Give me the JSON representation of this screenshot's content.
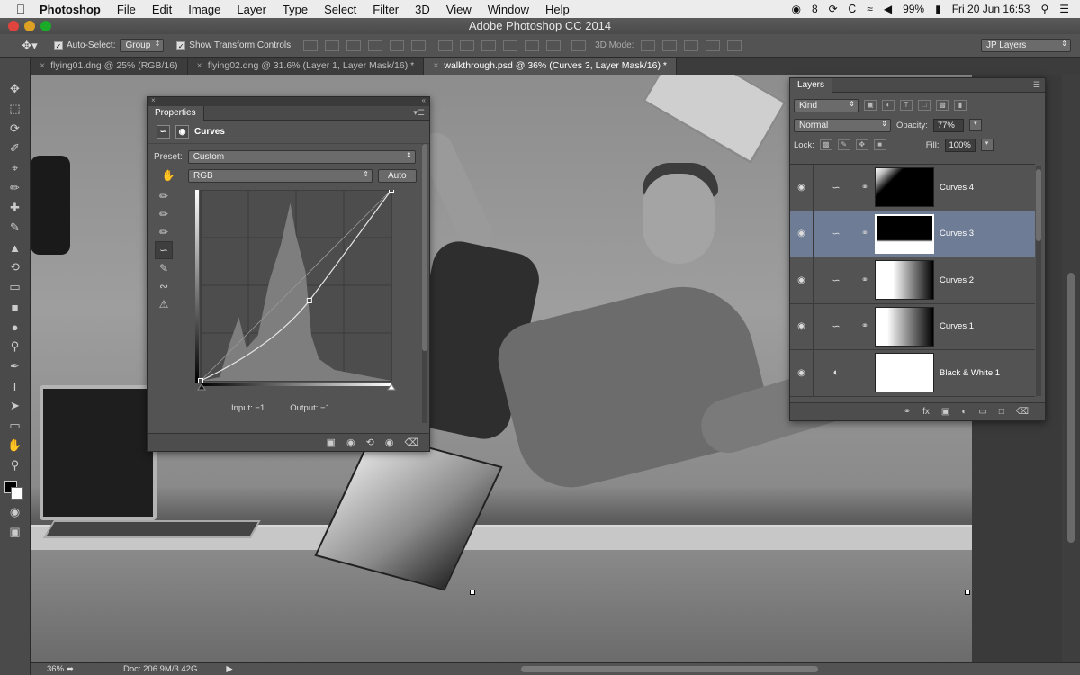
{
  "menubar": {
    "apple_icon": "apple-icon",
    "app_name": "Photoshop",
    "menus": [
      "File",
      "Edit",
      "Image",
      "Layer",
      "Type",
      "Select",
      "Filter",
      "3D",
      "View",
      "Window",
      "Help"
    ],
    "status": {
      "cc_badge": "8",
      "battery": "99%",
      "datetime": "Fri 20 Jun  16:53"
    }
  },
  "window": {
    "title": "Adobe Photoshop CC 2014"
  },
  "options_bar": {
    "auto_select_label": "Auto-Select:",
    "auto_select_value": "Group",
    "show_transform_label": "Show Transform Controls",
    "mode_3d_label": "3D Mode:",
    "workspace_value": "JP Layers"
  },
  "tabs": [
    {
      "label": "flying01.dng @ 25% (RGB/16)",
      "active": false
    },
    {
      "label": "flying02.dng @ 31.6% (Layer 1, Layer Mask/16) *",
      "active": false
    },
    {
      "label": "walkthrough.psd @ 36% (Curves 3, Layer Mask/16) *",
      "active": true
    }
  ],
  "status_bar": {
    "zoom": "36%",
    "doc": "Doc: 206.9M/3.42G"
  },
  "properties": {
    "tab_label": "Properties",
    "header_label": "Curves",
    "preset_label": "Preset:",
    "preset_value": "Custom",
    "channel_value": "RGB",
    "auto_button": "Auto",
    "input_label": "Input: −1",
    "output_label": "Output: −1",
    "curve_points": [
      [
        0,
        0
      ],
      [
        0.57,
        0.42
      ],
      [
        1,
        1
      ]
    ]
  },
  "layers": {
    "tab_label": "Layers",
    "filter_value": "Kind",
    "blend_mode": "Normal",
    "opacity_label": "Opacity:",
    "opacity_value": "77%",
    "lock_label": "Lock:",
    "fill_label": "Fill:",
    "fill_value": "100%",
    "items": [
      {
        "name": "Curves 4",
        "selected": false
      },
      {
        "name": "Curves 3",
        "selected": true
      },
      {
        "name": "Curves 2",
        "selected": false
      },
      {
        "name": "Curves 1",
        "selected": false
      },
      {
        "name": "Black & White 1",
        "selected": false
      }
    ]
  }
}
